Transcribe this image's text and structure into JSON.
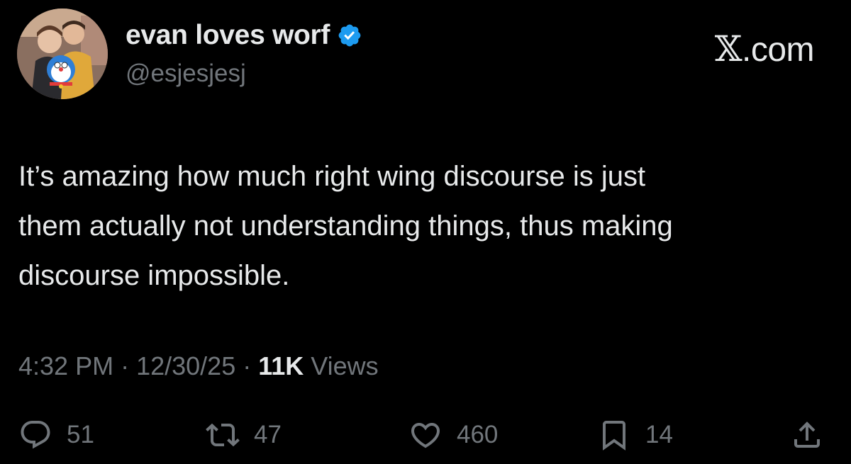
{
  "author": {
    "display_name": "evan loves worf",
    "handle": "@esjesjesj",
    "verified": true,
    "verified_color": "#1d9bf0"
  },
  "brand": {
    "x": "𝕏",
    "suffix": ".com"
  },
  "tweet": {
    "text": "It’s amazing how much right wing discourse is just\nthem actually not understanding things, thus making\ndiscourse impossible."
  },
  "meta": {
    "time": "4:32 PM",
    "sep1": " · ",
    "date": "12/30/25",
    "sep2": " · ",
    "views_count": "11K",
    "views_label": " Views"
  },
  "actions": {
    "replies": "51",
    "reposts": "47",
    "likes": "460",
    "bookmarks": "14"
  },
  "icons": {
    "reply": "reply-icon",
    "repost": "repost-icon",
    "like": "heart-icon",
    "bookmark": "bookmark-icon",
    "share": "share-icon"
  },
  "colors": {
    "background": "#000000",
    "primary_text": "#e7e9ea",
    "secondary_text": "#71767b"
  }
}
